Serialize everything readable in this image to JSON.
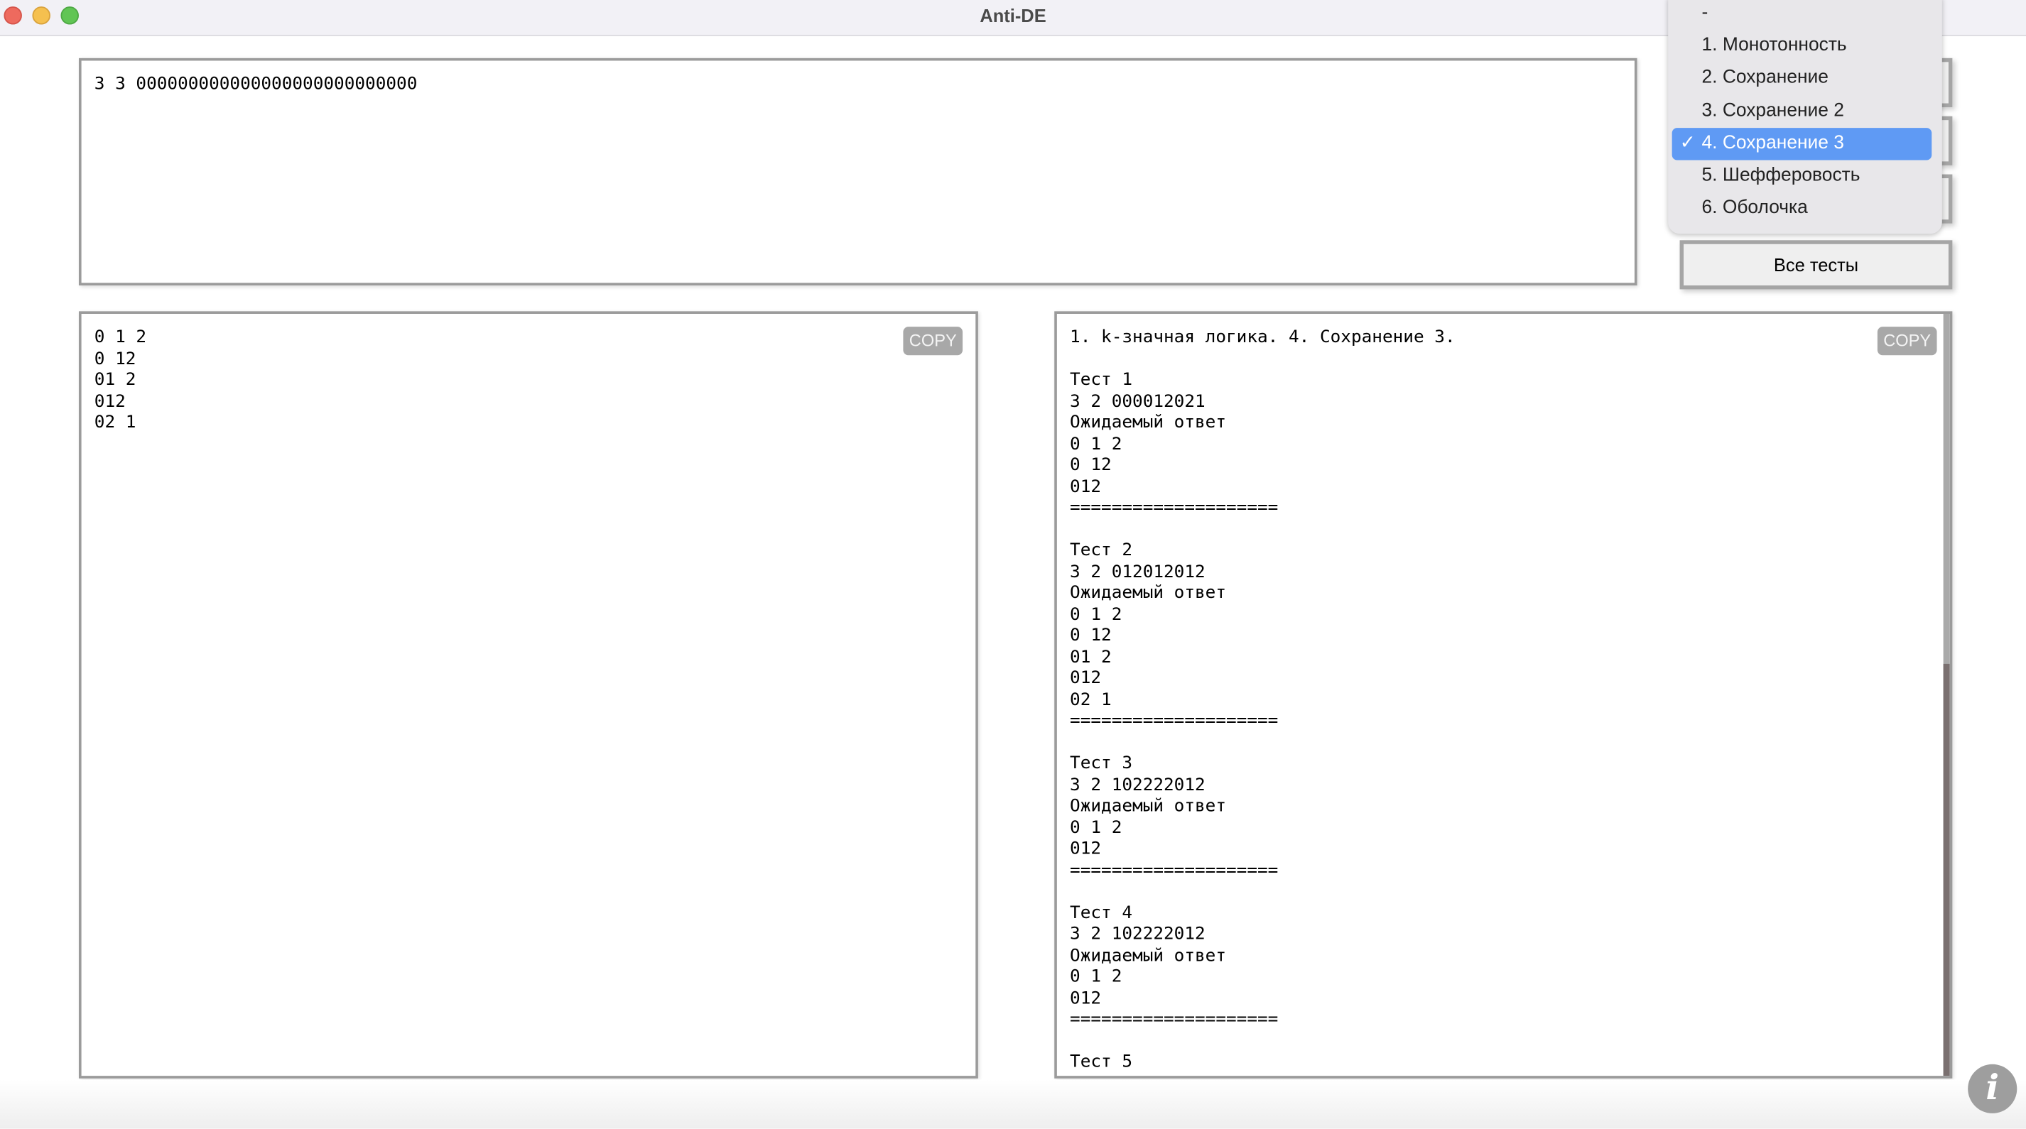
{
  "window": {
    "title": "Anti-DE"
  },
  "input": {
    "value": "3 3 000000000000000000000000000"
  },
  "output_left": {
    "text": "0 1 2\n0 12\n01 2\n012\n02 1",
    "copy_label": "COPY"
  },
  "output_right": {
    "text": "1. k-значная логика. 4. Сохранение 3.\n\nТест 1\n3 2 000012021\nОжидаемый ответ\n0 1 2\n0 12\n012\n====================\n\nТест 2\n3 2 012012012\nОжидаемый ответ\n0 1 2\n0 12\n01 2\n012\n02 1\n====================\n\nТест 3\n3 2 102222012\nОжидаемый ответ\n0 1 2\n012\n====================\n\nТест 4\n3 2 102222012\nОжидаемый ответ\n0 1 2\n012\n====================\n\nТест 5",
    "copy_label": "COPY",
    "scroll_position_percent": 46
  },
  "dropdown": {
    "selected": "4. Сохранение 3",
    "items": [
      {
        "label": "-"
      },
      {
        "label": "1. Монотонность"
      },
      {
        "label": "2. Сохранение"
      },
      {
        "label": "3. Сохранение 2"
      },
      {
        "label": "4. Сохранение 3",
        "check": "✓"
      },
      {
        "label": "5. Шефферовость"
      },
      {
        "label": "6. Оболочка"
      }
    ],
    "highlight_color": "#5f9af4"
  },
  "buttons": {
    "all_tests": "Все тесты"
  },
  "info_icon": {
    "glyph": "i"
  }
}
